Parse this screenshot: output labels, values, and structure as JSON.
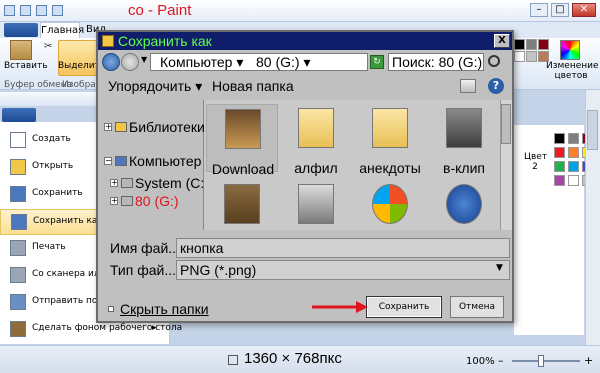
{
  "paint": {
    "title": "co - Paint",
    "tabs": [
      "Главная",
      "Вид"
    ],
    "clipboard": {
      "paste_label": "Вставить",
      "group_label": "Буфер обмена"
    },
    "image": {
      "select_label": "Выделить",
      "group_label": "Изображе"
    },
    "edit_colors_label": "Изменение цветов",
    "color2_label": "Цвет 2",
    "window_controls": {
      "minimize": "–",
      "maximize": "□",
      "close": "✕"
    },
    "status": {
      "dimensions": "1360 × 768пкс",
      "zoom": "100%",
      "zoom_minus": "–",
      "zoom_plus": "+"
    },
    "palette_colors": [
      "#000000",
      "#7f7f7f",
      "#880015",
      "#ed1c24",
      "#ff7f27",
      "#fff200",
      "#22b14c",
      "#00a2e8",
      "#3f48cc",
      "#a349a4",
      "#ffffff",
      "#c3c3c3",
      "#b97a57",
      "#ffaec9",
      "#ffc90e",
      "#efe4b0",
      "#b5e61d",
      "#99d9ea",
      "#7092be",
      "#c8bfe7"
    ]
  },
  "file_menu": {
    "items": [
      {
        "label": "Создать",
        "icon": "new-file-icon"
      },
      {
        "label": "Открыть",
        "icon": "open-folder-icon"
      },
      {
        "label": "Сохранить",
        "icon": "save-disk-icon"
      },
      {
        "label": "Сохранить как",
        "icon": "save-as-icon"
      },
      {
        "label": "Печать",
        "icon": "printer-icon"
      },
      {
        "label": "Со сканера или камеры",
        "icon": "scanner-icon"
      },
      {
        "label": "Отправить по элект...",
        "icon": "email-icon"
      },
      {
        "label": "Сделать фоном рабочего стола",
        "icon": "desktop-background-icon"
      }
    ]
  },
  "dialog": {
    "title": "Сохранить как",
    "close": "X",
    "breadcrumb": {
      "computer": "Компьютер ▾",
      "drive": "80 (G:) ▾"
    },
    "search_placeholder": "Поиск: 80 (G:)",
    "toolbar": {
      "organize": "Упорядочить ▾",
      "new_folder": "Новая папка",
      "help": "?"
    },
    "nav_tree": [
      {
        "label": "Библиотеки",
        "exp": "+"
      },
      {
        "label": "Компьютер",
        "exp": "−"
      },
      {
        "label": "System (C:",
        "exp": "+"
      },
      {
        "label": "80 (G:)",
        "exp": "+"
      }
    ],
    "files": [
      {
        "label": "Download",
        "icon": "folder-photo-icon"
      },
      {
        "label": "алфил",
        "icon": "folder-icon"
      },
      {
        "label": "анекдоты",
        "icon": "folder-icon"
      },
      {
        "label": "в-клип",
        "icon": "video-camera-icon"
      },
      {
        "label": "",
        "icon": "clipboard-icon"
      },
      {
        "label": "",
        "icon": "speaker-icon"
      },
      {
        "label": "",
        "icon": "windows-logo-icon"
      },
      {
        "label": "",
        "icon": "help-circle-icon"
      }
    ],
    "filename_label": "Имя фай...",
    "filename_value": "кнопка",
    "filetype_label": "Тип фай...",
    "filetype_value": "PNG (*.png)",
    "hide_folders": "Скрыть папки",
    "save_button": "Сохранить",
    "cancel_button": "Отмена",
    "accent_colors": {
      "title_bar": "#101d6b",
      "title_text": "#62ff47",
      "annotation_arrow": "#e0141e"
    }
  }
}
